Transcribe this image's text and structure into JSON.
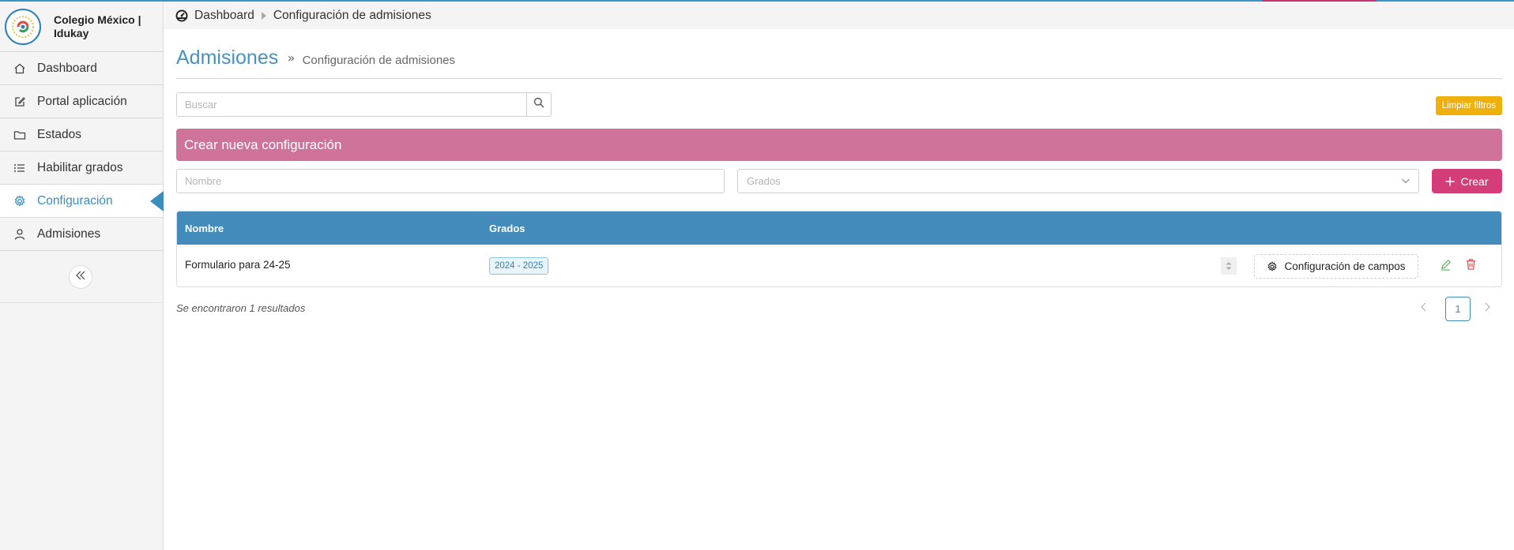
{
  "brand": {
    "name": "Colegio México | Idukay",
    "logo_icon": "school-crest"
  },
  "sidebar": {
    "items": [
      {
        "label": "Dashboard",
        "icon": "home-icon"
      },
      {
        "label": "Portal aplicación",
        "icon": "edit-icon"
      },
      {
        "label": "Estados",
        "icon": "folder-icon"
      },
      {
        "label": "Habilitar grados",
        "icon": "list-icon"
      },
      {
        "label": "Configuración",
        "icon": "gear-icon",
        "active": true
      },
      {
        "label": "Admisiones",
        "icon": "user-icon"
      }
    ],
    "collapse_icon": "double-chevron-left-icon"
  },
  "breadcrumb": {
    "home": "Dashboard",
    "current": "Configuración de admisiones"
  },
  "page": {
    "title": "Admisiones",
    "subtitle": "Configuración de admisiones"
  },
  "search": {
    "placeholder": "Buscar",
    "value": ""
  },
  "filters": {
    "clear_label": "Limpiar filtros"
  },
  "create_form": {
    "banner": "Crear nueva configuración",
    "name_placeholder": "Nombre",
    "grades_placeholder": "Grados",
    "create_label": "Crear"
  },
  "table": {
    "headers": {
      "name": "Nombre",
      "grades": "Grados"
    },
    "rows": [
      {
        "name": "Formulario para 24-25",
        "grade": "2024 - 2025",
        "fields_button": "Configuración de campos"
      }
    ]
  },
  "results": {
    "text": "Se encontraron 1 resultados"
  },
  "pagination": {
    "current": "1"
  },
  "colors": {
    "primary": "#428bba",
    "banner": "#d0739a",
    "create_button": "#d43e78",
    "clear_button": "#efb00a"
  }
}
